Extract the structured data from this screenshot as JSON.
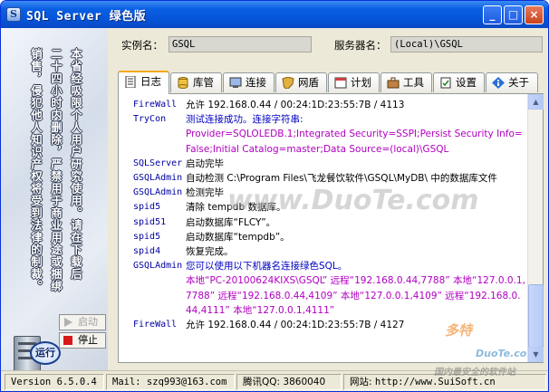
{
  "window": {
    "title": "SQL Server 绿色版",
    "app_icon": "S",
    "controls": {
      "minimize": "_",
      "maximize": "□",
      "close": "×"
    }
  },
  "left_panel": {
    "notice_columns": [
      "本省经吸限个人用户研究使用。请在下载后",
      "二十四小时内删除，严禁用于商业用途或捆绑",
      "销售，侵犯他人知识产权将受到法律的制裁。"
    ],
    "run_button": "运行",
    "start_button": "启动",
    "stop_button": "停止"
  },
  "instance": {
    "label": "实例名：",
    "value": "GSQL"
  },
  "server": {
    "label": "服务器名：",
    "value": "(Local)\\GSQL"
  },
  "tabs": [
    {
      "label": "日志",
      "icon": "log-icon",
      "active": true
    },
    {
      "label": "库管",
      "icon": "database-icon"
    },
    {
      "label": "连接",
      "icon": "connect-icon"
    },
    {
      "label": "网盾",
      "icon": "shield-icon"
    },
    {
      "label": "计划",
      "icon": "plan-icon"
    },
    {
      "label": "工具",
      "icon": "tools-icon"
    },
    {
      "label": "设置",
      "icon": "settings-icon"
    },
    {
      "label": "关于",
      "icon": "about-icon"
    }
  ],
  "log": [
    {
      "source": "FireWall",
      "message": "允许 192.168.0.44 / 00:24:1D:23:55:7B / 4113",
      "color": "c-ok"
    },
    {
      "source": "TryCon",
      "message": "测试连接成功。连接字符串:",
      "color": "c-blue"
    },
    {
      "source": "",
      "message": "Provider=SQLOLEDB.1;Integrated Security=SSPI;Persist Security Info=False;Initial Catalog=master;Data Source=(local)\\GSQL",
      "color": "c-purple"
    },
    {
      "source": "SQLServer",
      "message": "启动完毕",
      "color": "c-ok"
    },
    {
      "source": "GSQLAdmin",
      "message": "自动检测 C:\\Program Files\\飞龙餐饮软件\\GSQL\\MyDB\\ 中的数据库文件",
      "color": "c-ok"
    },
    {
      "source": "GSQLAdmin",
      "message": "检测完毕",
      "color": "c-ok"
    },
    {
      "source": "spid5",
      "message": "清除 tempdb 数据库。",
      "color": "c-ok"
    },
    {
      "source": "spid51",
      "message": "启动数据库“FLCY”。",
      "color": "c-ok"
    },
    {
      "source": "spid5",
      "message": "启动数据库“tempdb”。",
      "color": "c-ok"
    },
    {
      "source": "spid4",
      "message": "恢复完成。",
      "color": "c-ok"
    },
    {
      "source": "GSQLAdmin",
      "message": "您可以使用以下机器名连接绿色SQL。",
      "color": "c-blue"
    },
    {
      "source": "",
      "message": "本地“PC-20100624KIXS\\GSQL” 远程“192.168.0.44,7788” 本地“127.0.0.1,7788” 远程“192.168.0.44,4109” 本地“127.0.0.1,4109” 远程“192.168.0.44,4111” 本地“127.0.0.1,4111”",
      "color": "c-purple"
    },
    {
      "source": "FireWall",
      "message": "允许 192.168.0.44 / 00:24:1D:23:55:7B / 4127",
      "color": "c-ok"
    }
  ],
  "watermarks": {
    "center": "www.DuoTe.com",
    "corner_main": "多特",
    "corner_sub": "DuoTe.com",
    "corner_cn": "国内最安全的软件站"
  },
  "status": {
    "version": "Version 6.5.0.4",
    "mail": "Mail: szq993@163.com",
    "qq": "腾讯QQ: 3860040",
    "site_label": "网站:",
    "site": "http://www.SuiSoft.cn"
  }
}
